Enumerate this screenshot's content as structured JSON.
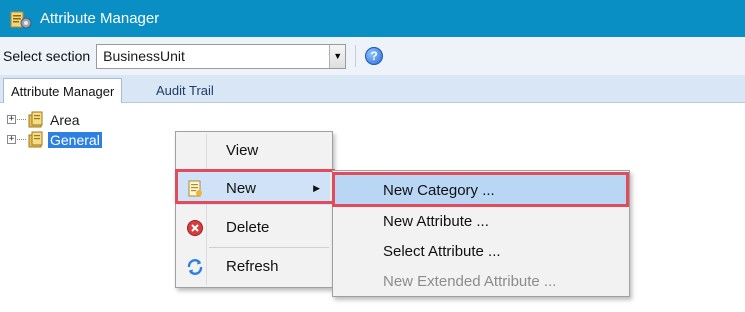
{
  "window": {
    "title": "Attribute Manager",
    "icon": "attribute-manager-icon"
  },
  "section_bar": {
    "label": "Select section",
    "selected_value": "BusinessUnit",
    "dropdown_icon": "chevron-down-icon",
    "help_icon_glyph": "?",
    "help_icon": "help-icon"
  },
  "tabs": [
    {
      "label": "Attribute Manager",
      "active": true
    },
    {
      "label": "Audit Trail",
      "active": false
    }
  ],
  "tree": {
    "nodes": [
      {
        "label": "Area",
        "expander": "+",
        "icon": "folder-icon",
        "selected": false
      },
      {
        "label": "General",
        "expander": "+",
        "icon": "folder-icon",
        "selected": true
      }
    ]
  },
  "context_menu": {
    "items": [
      {
        "label": "View",
        "icon": ""
      },
      {
        "label": "New",
        "icon": "new-document-icon",
        "has_submenu": true,
        "submenu_arrow": "▶"
      },
      {
        "label": "Delete",
        "icon": "delete-icon"
      },
      {
        "label": "Refresh",
        "icon": "refresh-icon"
      }
    ]
  },
  "submenu": {
    "items": [
      {
        "label": "New Category ...",
        "enabled": true,
        "highlighted": true
      },
      {
        "label": "New Attribute ...",
        "enabled": true
      },
      {
        "label": "Select Attribute ...",
        "enabled": true
      },
      {
        "label": "New Extended Attribute ...",
        "enabled": false
      }
    ]
  },
  "colors": {
    "titlebar": "#0a8fc4",
    "highlight_box": "#e24b5a",
    "selection": "#2d7fe0"
  }
}
